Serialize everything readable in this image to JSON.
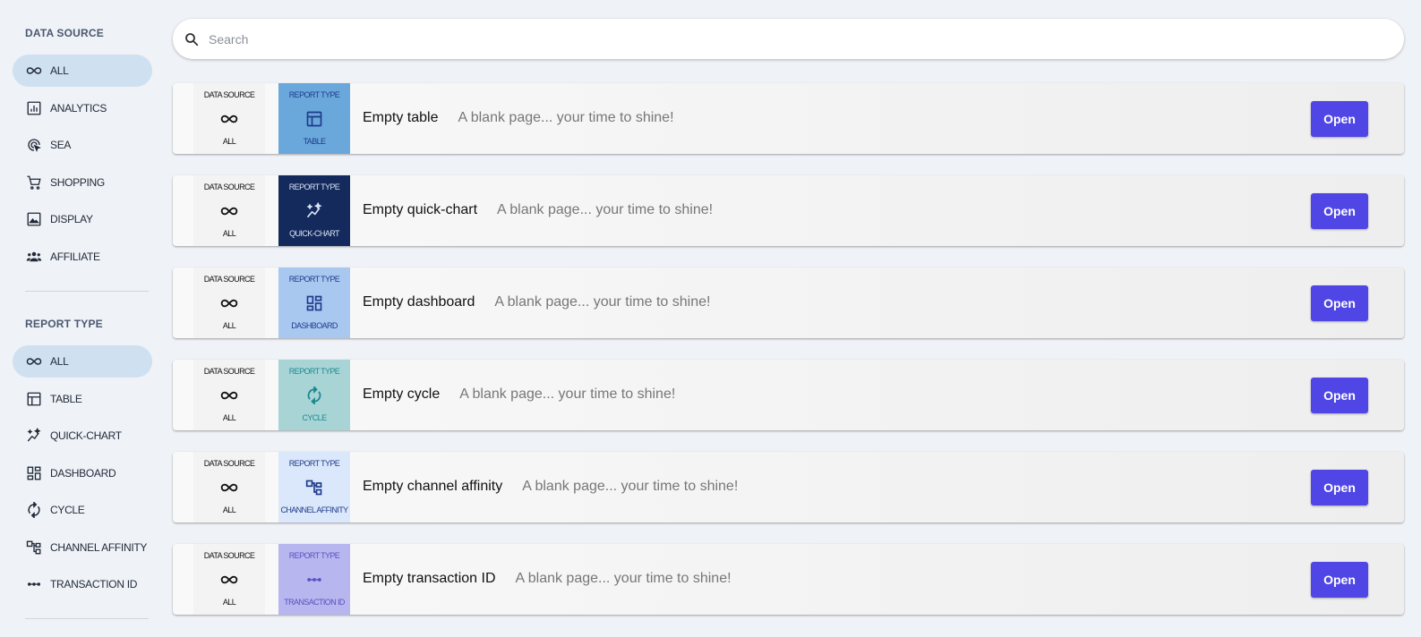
{
  "sidebar": {
    "data_source_title": "DATA SOURCE",
    "data_source_items": [
      {
        "label": "ALL",
        "icon": "infinity-icon"
      },
      {
        "label": "ANALYTICS",
        "icon": "analytics-icon"
      },
      {
        "label": "SEA",
        "icon": "target-click-icon"
      },
      {
        "label": "SHOPPING",
        "icon": "cart-icon"
      },
      {
        "label": "DISPLAY",
        "icon": "image-icon"
      },
      {
        "label": "AFFILIATE",
        "icon": "people-icon"
      }
    ],
    "report_type_title": "REPORT TYPE",
    "report_type_items": [
      {
        "label": "ALL",
        "icon": "infinity-icon"
      },
      {
        "label": "TABLE",
        "icon": "table-icon"
      },
      {
        "label": "QUICK-CHART",
        "icon": "sparkle-chart-icon"
      },
      {
        "label": "DASHBOARD",
        "icon": "dashboard-icon"
      },
      {
        "label": "CYCLE",
        "icon": "cycle-icon"
      },
      {
        "label": "CHANNEL AFFINITY",
        "icon": "channel-affinity-icon"
      },
      {
        "label": "TRANSACTION ID",
        "icon": "transaction-icon"
      }
    ]
  },
  "search": {
    "placeholder": "Search"
  },
  "cards": [
    {
      "ds_header": "DATA SOURCE",
      "ds_value": "ALL",
      "rt_header": "REPORT TYPE",
      "rt_value": "TABLE",
      "title": "Empty table",
      "description": "A blank page... your time to shine!",
      "button": "Open",
      "rt_bg": "#6aa8dc",
      "rt_fg": "#1e3a8a"
    },
    {
      "ds_header": "DATA SOURCE",
      "ds_value": "ALL",
      "rt_header": "REPORT TYPE",
      "rt_value": "QUICK-CHART",
      "title": "Empty quick-chart",
      "description": "A blank page... your time to shine!",
      "button": "Open",
      "rt_bg": "#142a5c",
      "rt_fg": "#d9e2f5"
    },
    {
      "ds_header": "DATA SOURCE",
      "ds_value": "ALL",
      "rt_header": "REPORT TYPE",
      "rt_value": "DASHBOARD",
      "title": "Empty dashboard",
      "description": "A blank page... your time to shine!",
      "button": "Open",
      "rt_bg": "#a9c8f0",
      "rt_fg": "#1e3a8a"
    },
    {
      "ds_header": "DATA SOURCE",
      "ds_value": "ALL",
      "rt_header": "REPORT TYPE",
      "rt_value": "CYCLE",
      "title": "Empty cycle",
      "description": "A blank page... your time to shine!",
      "button": "Open",
      "rt_bg": "#a8d4d6",
      "rt_fg": "#1c8a8f"
    },
    {
      "ds_header": "DATA SOURCE",
      "ds_value": "ALL",
      "rt_header": "REPORT TYPE",
      "rt_value": "CHANNEL AFFINITY",
      "title": "Empty channel affinity",
      "description": "A blank page... your time to shine!",
      "button": "Open",
      "rt_bg": "#dbe8fb",
      "rt_fg": "#1e3a8a"
    },
    {
      "ds_header": "DATA SOURCE",
      "ds_value": "ALL",
      "rt_header": "REPORT TYPE",
      "rt_value": "TRANSACTION ID",
      "title": "Empty transaction ID",
      "description": "A blank page... your time to shine!",
      "button": "Open",
      "rt_bg": "#b8b6ee",
      "rt_fg": "#5b4fc4"
    }
  ],
  "colors": {
    "accent": "#4f46e5",
    "active_nav": "#cfe0f1",
    "background": "#eff2f7"
  }
}
